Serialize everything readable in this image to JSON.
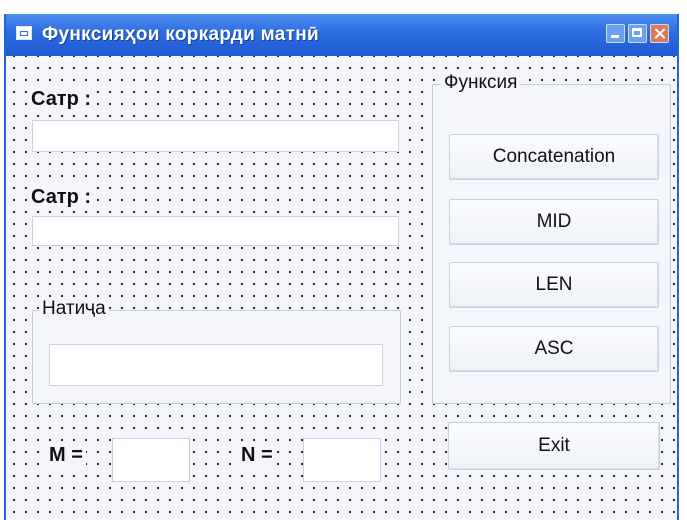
{
  "window": {
    "title": "Функсияҳои коркарди матнӣ"
  },
  "fields": {
    "row1_label": "Сатр :",
    "row1_value": "",
    "row2_label": "Сатр :",
    "row2_value": "",
    "result_caption": "Натиҷа",
    "result_value": "",
    "m_label": "M =",
    "m_value": "",
    "n_label": "N =",
    "n_value": ""
  },
  "functions": {
    "caption": "Функсия",
    "buttons": [
      "Concatenation",
      "MID",
      "LEN",
      "ASC"
    ]
  },
  "exit_label": "Exit"
}
